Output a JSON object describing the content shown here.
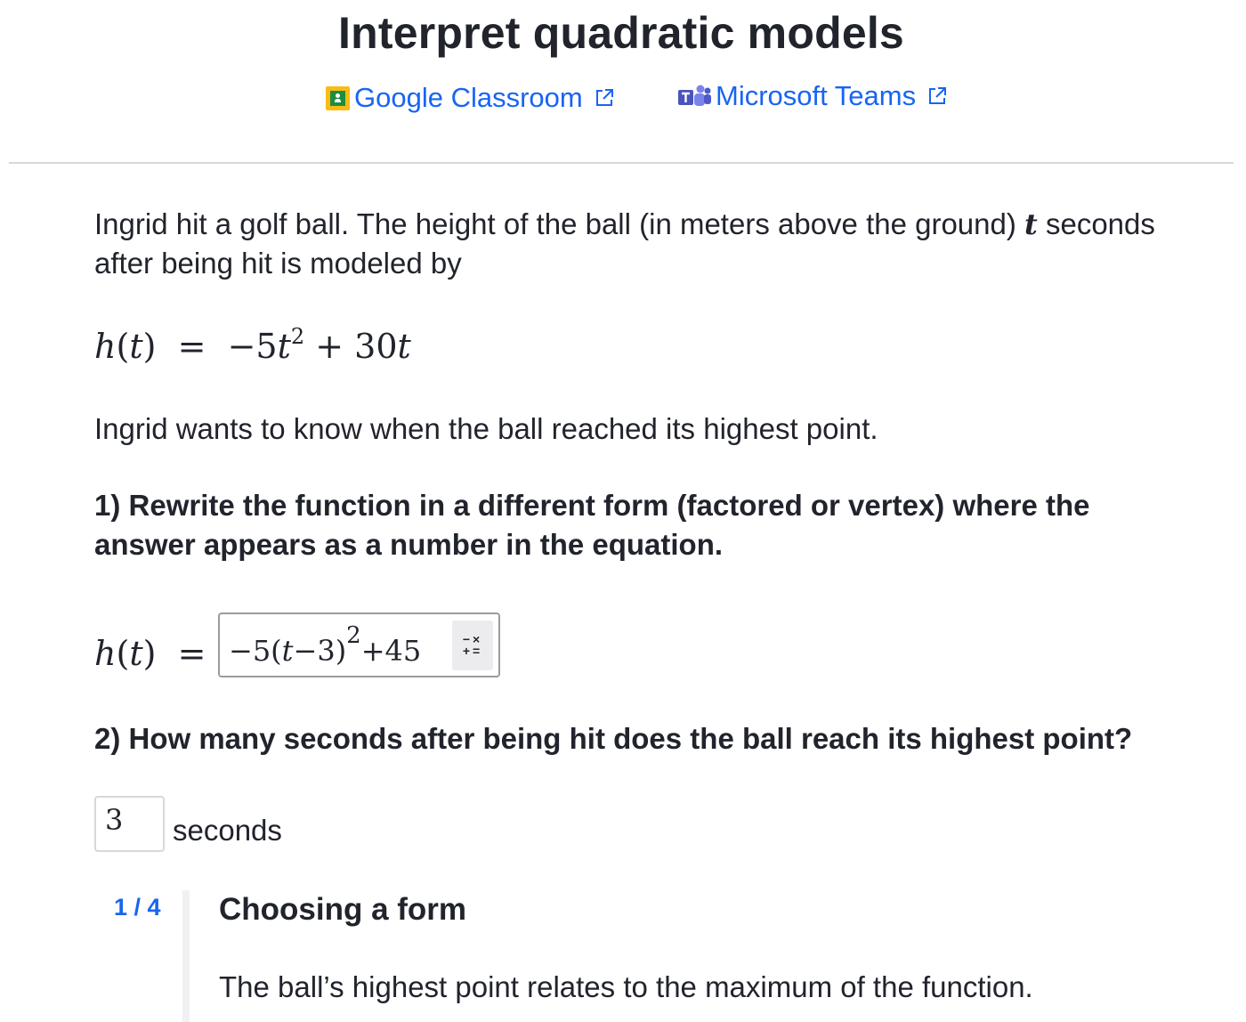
{
  "header": {
    "title": "Interpret quadratic models",
    "share_google": "Google Classroom",
    "share_teams": "Microsoft Teams",
    "icons": {
      "google": "google-classroom-icon",
      "teams": "microsoft-teams-icon",
      "external": "external-link-icon"
    },
    "colors": {
      "link": "#1865f2",
      "text": "#21242c"
    }
  },
  "problem": {
    "intro_before_t": "Ingrid hit a golf ball. The height of the ball (in meters above the ground) ",
    "intro_var": "t",
    "intro_after_t": " seconds after being hit is modeled by",
    "model_lhs_fn": "h",
    "model_lhs_var": "t",
    "model_rhs_a": "−5",
    "model_rhs_var": "t",
    "model_rhs_exp": "2",
    "model_rhs_b": " + 30",
    "model_rhs_var2": "t",
    "goal": "Ingrid wants to know when the ball reached its highest point.",
    "question1": "1) Rewrite the function in a different form (factored or vertex) where the answer appears as a number in the equation.",
    "answer1_lhs_fn": "h",
    "answer1_lhs_var": "t",
    "answer1_value_pre": "−5(",
    "answer1_value_var": "t",
    "answer1_value_mid": "−3)",
    "answer1_value_exp": "2",
    "answer1_value_post": "+45",
    "question2": "2) How many seconds after being hit does the ball reach its highest point?",
    "answer2_value": "3",
    "answer2_unit": "seconds"
  },
  "hint": {
    "counter": "1 / 4",
    "title": "Choosing a form",
    "text": "The ball’s highest point relates to the maximum of the function."
  }
}
